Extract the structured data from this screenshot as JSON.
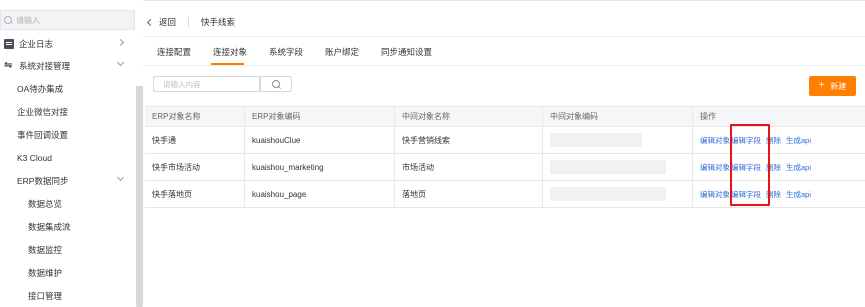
{
  "sidebar": {
    "search_placeholder": "请输入",
    "items": [
      {
        "label": "企业日志",
        "icon": "log-icon"
      },
      {
        "label": "系统对接管理",
        "icon": "link-icon"
      },
      {
        "label": "OA待办集成"
      },
      {
        "label": "企业微信对接"
      },
      {
        "label": "事件回调设置"
      },
      {
        "label": "K3 Cloud"
      },
      {
        "label": "ERP数据同步"
      },
      {
        "label": "数据总览"
      },
      {
        "label": "数据集成流"
      },
      {
        "label": "数据监控"
      },
      {
        "label": "数据维护"
      },
      {
        "label": "接口管理"
      }
    ]
  },
  "breadcrumb": {
    "back_label": "返回",
    "current": "快手线索"
  },
  "tabs": [
    {
      "label": "连接配置"
    },
    {
      "label": "连接对象",
      "active": true
    },
    {
      "label": "系统字段"
    },
    {
      "label": "账户绑定"
    },
    {
      "label": "同步通知设置"
    }
  ],
  "toolbar": {
    "search_placeholder": "请输入内容",
    "new_label": "新建"
  },
  "table": {
    "headers": [
      "ERP对象名称",
      "ERP对象编码",
      "中间对象名称",
      "中间对象编码",
      "操作"
    ],
    "rows": [
      {
        "erp_name": "快手通",
        "erp_code": "kuaishouClue",
        "mid_name": "快手营销线索",
        "mid_code": ""
      },
      {
        "erp_name": "快手市场活动",
        "erp_code": "kuaishou_marketing",
        "mid_name": "市场活动",
        "mid_code": ""
      },
      {
        "erp_name": "快手落地页",
        "erp_code": "kuaishou_page",
        "mid_name": "落地页",
        "mid_code": ""
      }
    ],
    "actions": {
      "edit_object": "编辑对象",
      "edit_field": "编辑字段",
      "delete": "删除",
      "generate_api": "生成api"
    }
  },
  "colors": {
    "accent": "#ff8000",
    "link": "#2c6cd8",
    "highlight": "#e5141b"
  }
}
